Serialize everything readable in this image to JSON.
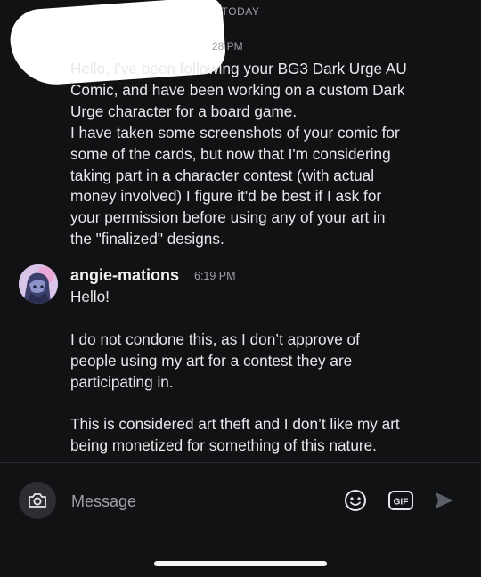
{
  "day_divider": "TODAY",
  "messages": [
    {
      "author": "",
      "time": "28 PM",
      "text": "Hello, I've been following your BG3 Dark Urge AU\nComic, and have been working on a custom Dark\nUrge character for a board game.\nI have taken some screenshots of your comic for\nsome of the cards, but now that I'm considering\ntaking part in a character contest (with actual\nmoney involved) I figure it'd be best if I ask for\nyour permission before using any of your art in\nthe \"finalized\" designs."
    },
    {
      "author": "angie-mations",
      "time": "6:19 PM",
      "text": "Hello!\n\nI do not condone this, as I don’t approve of\npeople using my art for a contest they are\nparticipating in.\n\nThis is considered art theft and I don’t like my art\nbeing monetized for something of this nature."
    }
  ],
  "composer": {
    "placeholder": "Message",
    "camera_icon": "camera-icon",
    "emoji_icon": "emoji-icon",
    "gif_label": "GIF",
    "send_icon": "send-icon"
  },
  "colors": {
    "background": "#111214",
    "text": "#e8e9ec",
    "muted": "#9ea0a6",
    "button_bg": "#2c2e33"
  }
}
